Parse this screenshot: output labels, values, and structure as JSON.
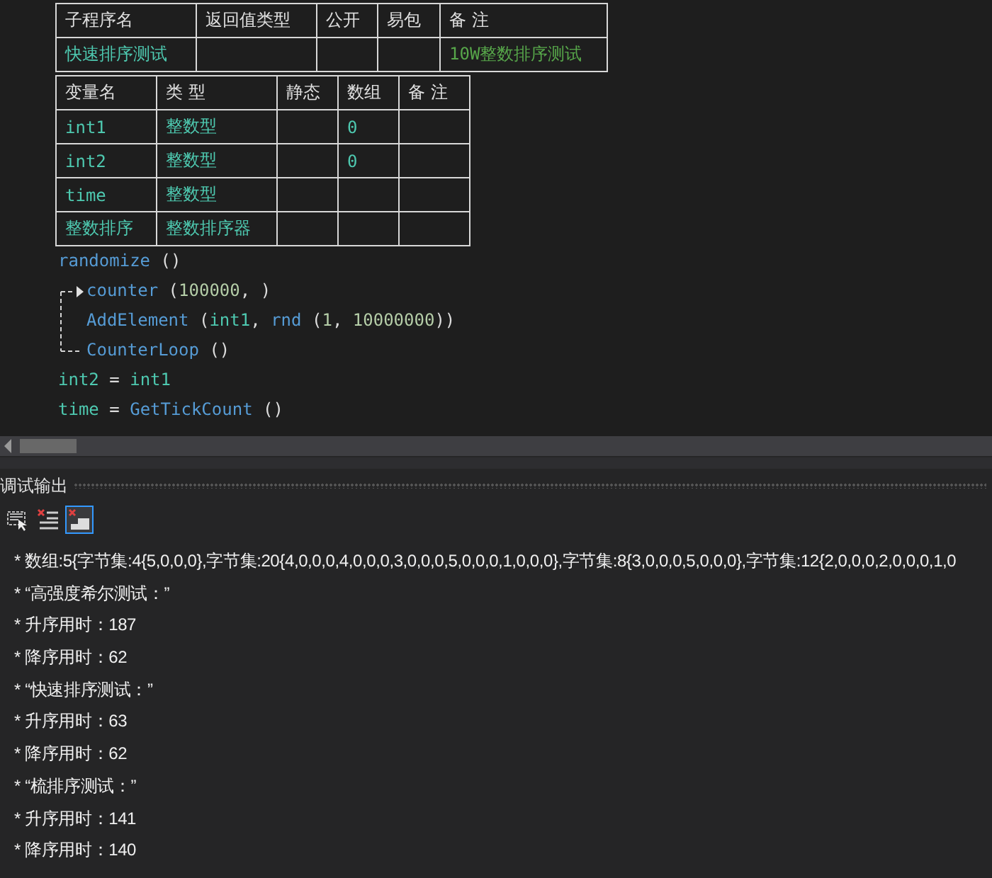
{
  "procedure_table": {
    "columns": [
      "子程序名",
      "返回值类型",
      "公开",
      "易包",
      "备 注"
    ],
    "rows": [
      {
        "name": "快速排序测试",
        "remark": "10W整数排序测试"
      }
    ]
  },
  "variable_table": {
    "columns": [
      "变量名",
      "类 型",
      "静态",
      "数组",
      "备 注"
    ],
    "rows": [
      {
        "name": "int1",
        "type": "整数型",
        "array": "0"
      },
      {
        "name": "int2",
        "type": "整数型",
        "array": "0"
      },
      {
        "name": "time",
        "type": "整数型"
      },
      {
        "name": "整数排序",
        "type": "整数排序器"
      }
    ]
  },
  "code": [
    {
      "kind": "line",
      "tokens": [
        {
          "kind": "cmd",
          "text": "randomize"
        },
        {
          "kind": "punct",
          "text": " ()"
        }
      ]
    },
    {
      "kind": "loop",
      "head": [
        {
          "kind": "cmd",
          "text": "counter"
        },
        {
          "kind": "punct",
          "text": " ("
        },
        {
          "kind": "num",
          "text": "100000"
        },
        {
          "kind": "punct",
          "text": ", )"
        }
      ],
      "body": [
        [
          {
            "kind": "cmd",
            "text": "AddElement"
          },
          {
            "kind": "punct",
            "text": " ("
          },
          {
            "kind": "var",
            "text": "int1"
          },
          {
            "kind": "punct",
            "text": ", "
          },
          {
            "kind": "cmd",
            "text": "rnd"
          },
          {
            "kind": "punct",
            "text": " ("
          },
          {
            "kind": "num",
            "text": "1"
          },
          {
            "kind": "punct",
            "text": ", "
          },
          {
            "kind": "num",
            "text": "10000000"
          },
          {
            "kind": "punct",
            "text": "))"
          }
        ]
      ],
      "tail": [
        {
          "kind": "cmd",
          "text": "CounterLoop"
        },
        {
          "kind": "punct",
          "text": " ()"
        }
      ]
    },
    {
      "kind": "line",
      "tokens": [
        {
          "kind": "var",
          "text": "int2"
        },
        {
          "kind": "punct",
          "text": " =  "
        },
        {
          "kind": "var",
          "text": "int1"
        }
      ]
    },
    {
      "kind": "line",
      "tokens": [
        {
          "kind": "var",
          "text": "time"
        },
        {
          "kind": "punct",
          "text": " =  "
        },
        {
          "kind": "cmd",
          "text": "GetTickCount"
        },
        {
          "kind": "punct",
          "text": " ()"
        }
      ]
    }
  ],
  "output_panel": {
    "title": "调试输出",
    "tools": [
      {
        "kind": "select",
        "selected": false
      },
      {
        "kind": "clear",
        "selected": false
      },
      {
        "kind": "clear-all",
        "selected": true
      }
    ],
    "lines": [
      "* 数组:5{字节集:4{5,0,0,0},字节集:20{4,0,0,0,4,0,0,0,3,0,0,0,5,0,0,0,1,0,0,0},字节集:8{3,0,0,0,5,0,0,0},字节集:12{2,0,0,0,2,0,0,0,1,0",
      "*  “高强度希尔测试：”",
      "* 升序用时：187",
      "* 降序用时：62",
      "*  “快速排序测试：”",
      "* 升序用时：63",
      "* 降序用时：62",
      "*  “梳排序测试：”",
      "* 升序用时：141",
      "* 降序用时：140"
    ]
  }
}
